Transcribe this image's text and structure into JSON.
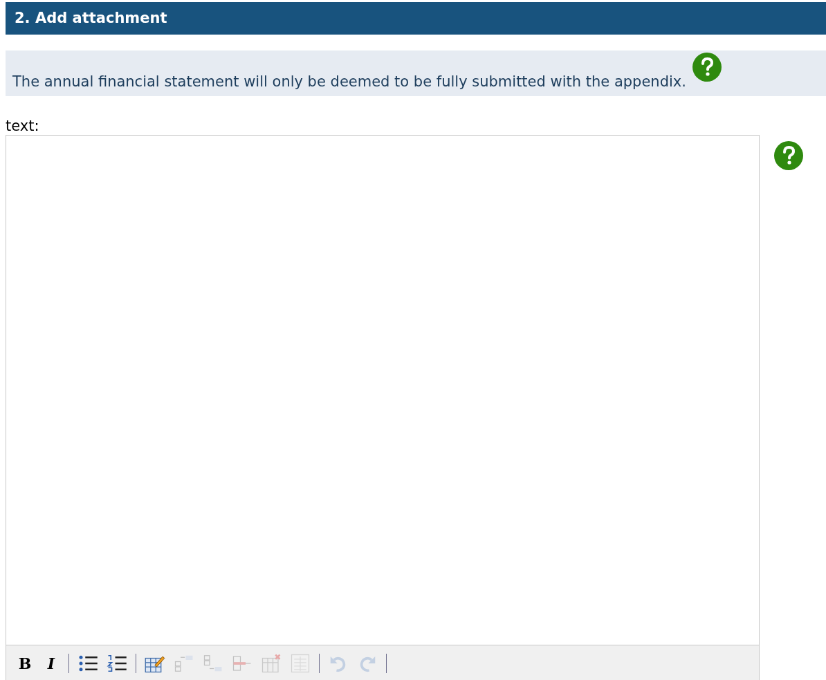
{
  "section": {
    "title": "2. Add attachment"
  },
  "notice": {
    "text": "The annual financial statement will only be deemed to be fully submitted with the appendix.",
    "help": true
  },
  "editor": {
    "label": "text:",
    "help": true,
    "toolbar": [
      {
        "kind": "letter",
        "label": "B",
        "disabled": false
      },
      {
        "kind": "letter",
        "label": "I",
        "disabled": false
      },
      {
        "kind": "separator"
      },
      {
        "kind": "icon",
        "disabled": false
      },
      {
        "kind": "icon",
        "disabled": false
      },
      {
        "kind": "separator"
      },
      {
        "kind": "icon",
        "disabled": false
      },
      {
        "kind": "icon",
        "disabled": true
      },
      {
        "kind": "icon",
        "disabled": true
      },
      {
        "kind": "icon",
        "disabled": true
      },
      {
        "kind": "icon",
        "disabled": true
      },
      {
        "kind": "icon",
        "disabled": true
      },
      {
        "kind": "separator"
      },
      {
        "kind": "icon",
        "disabled": true
      },
      {
        "kind": "icon",
        "disabled": true
      },
      {
        "kind": "separator"
      }
    ]
  }
}
